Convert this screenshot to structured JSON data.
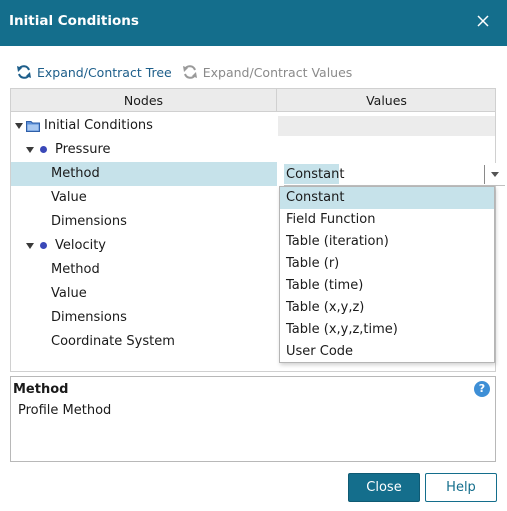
{
  "window": {
    "title": "Initial Conditions"
  },
  "toolbar": {
    "expand_tree": "Expand/Contract Tree",
    "expand_values": "Expand/Contract Values"
  },
  "tree": {
    "headers": {
      "nodes": "Nodes",
      "values": "Values"
    },
    "root": "Initial Conditions",
    "pressure": {
      "label": "Pressure",
      "method": "Method",
      "value": "Value",
      "dimensions": "Dimensions"
    },
    "velocity": {
      "label": "Velocity",
      "method": "Method",
      "value": "Value",
      "dimensions": "Dimensions",
      "coordinate_system": "Coordinate System"
    },
    "method_value": "Constant"
  },
  "dropdown": {
    "options": [
      "Constant",
      "Field Function",
      "Table (iteration)",
      "Table (r)",
      "Table (time)",
      "Table (x,y,z)",
      "Table (x,y,z,time)",
      "User Code"
    ],
    "highlighted": "Constant"
  },
  "info": {
    "title": "Method",
    "description": "Profile Method",
    "help_icon": "?"
  },
  "buttons": {
    "close": "Close",
    "help": "Help"
  },
  "colors": {
    "accent": "#146e8c",
    "selection": "#c6e2ea",
    "bullet": "#3a48b8",
    "help": "#3e8fd6"
  }
}
